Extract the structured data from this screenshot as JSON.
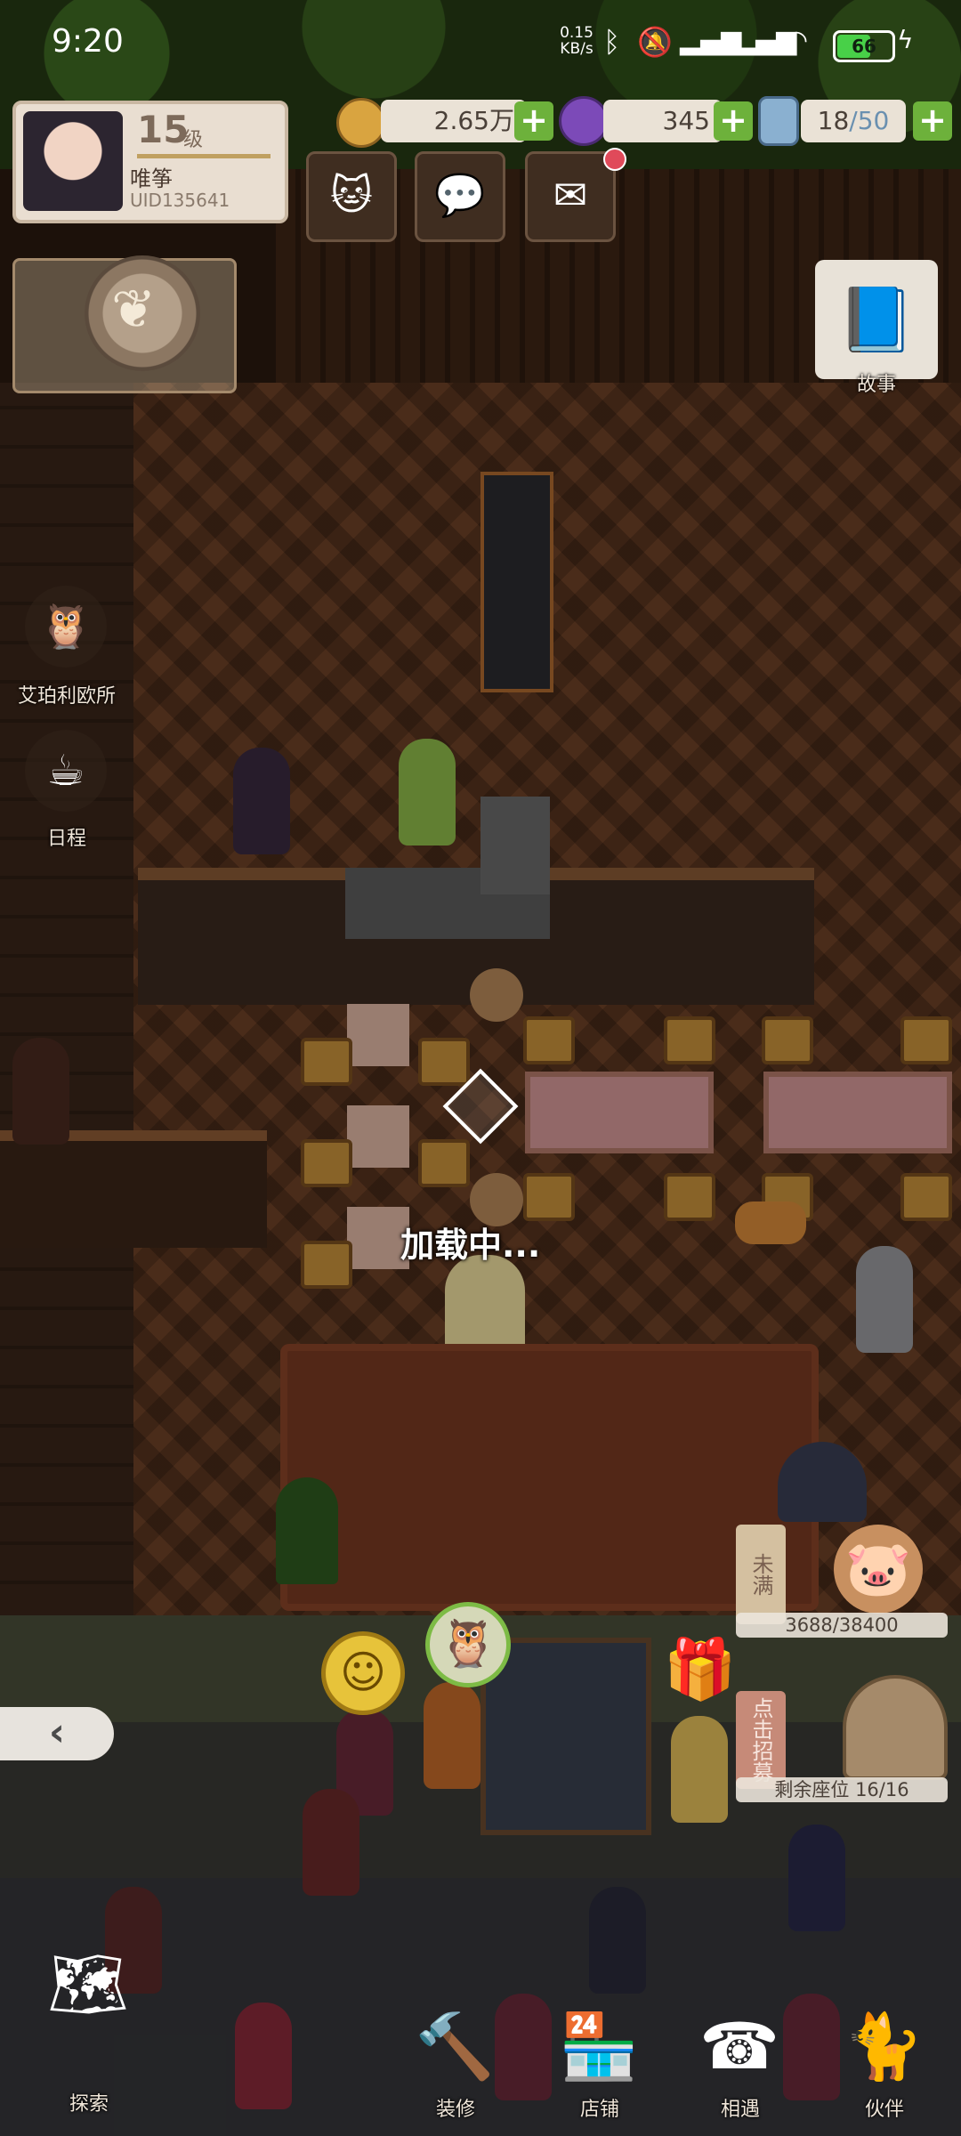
{
  "status_bar": {
    "time": "9:20",
    "net_speed": "0.15\nKB/s",
    "battery": "66",
    "battery_level": 0.66
  },
  "profile": {
    "level_number": "15",
    "level_unit": "级",
    "name": "唯筝",
    "uid": "UID135641"
  },
  "currencies": [
    {
      "value": "2.65万",
      "icon": "gold-coin-icon"
    },
    {
      "value": "345",
      "icon": "purple-gem-icon"
    },
    {
      "value_current": "18",
      "value_max": "/50",
      "icon": "bottle-icon"
    }
  ],
  "story": {
    "label": "故事"
  },
  "left_menu": {
    "agency": "艾珀利欧所",
    "schedule": "日程"
  },
  "loading_text": "加载中...",
  "tip_jar": {
    "status": "未满",
    "count": "3688/38400"
  },
  "recruit": {
    "label": "点击招募",
    "seats": "剩余座位 16/16"
  },
  "bottom_nav": [
    {
      "label": "探索",
      "icon": "map-icon"
    },
    {
      "label": "装修",
      "icon": "hammer-icon"
    },
    {
      "label": "店铺",
      "icon": "shop-icon"
    },
    {
      "label": "相遇",
      "icon": "telephone-icon"
    },
    {
      "label": "伙伴",
      "icon": "cat-card-icon"
    }
  ],
  "colors": {
    "plus_green": "#6db13b",
    "notification_red": "#e04a5a"
  }
}
